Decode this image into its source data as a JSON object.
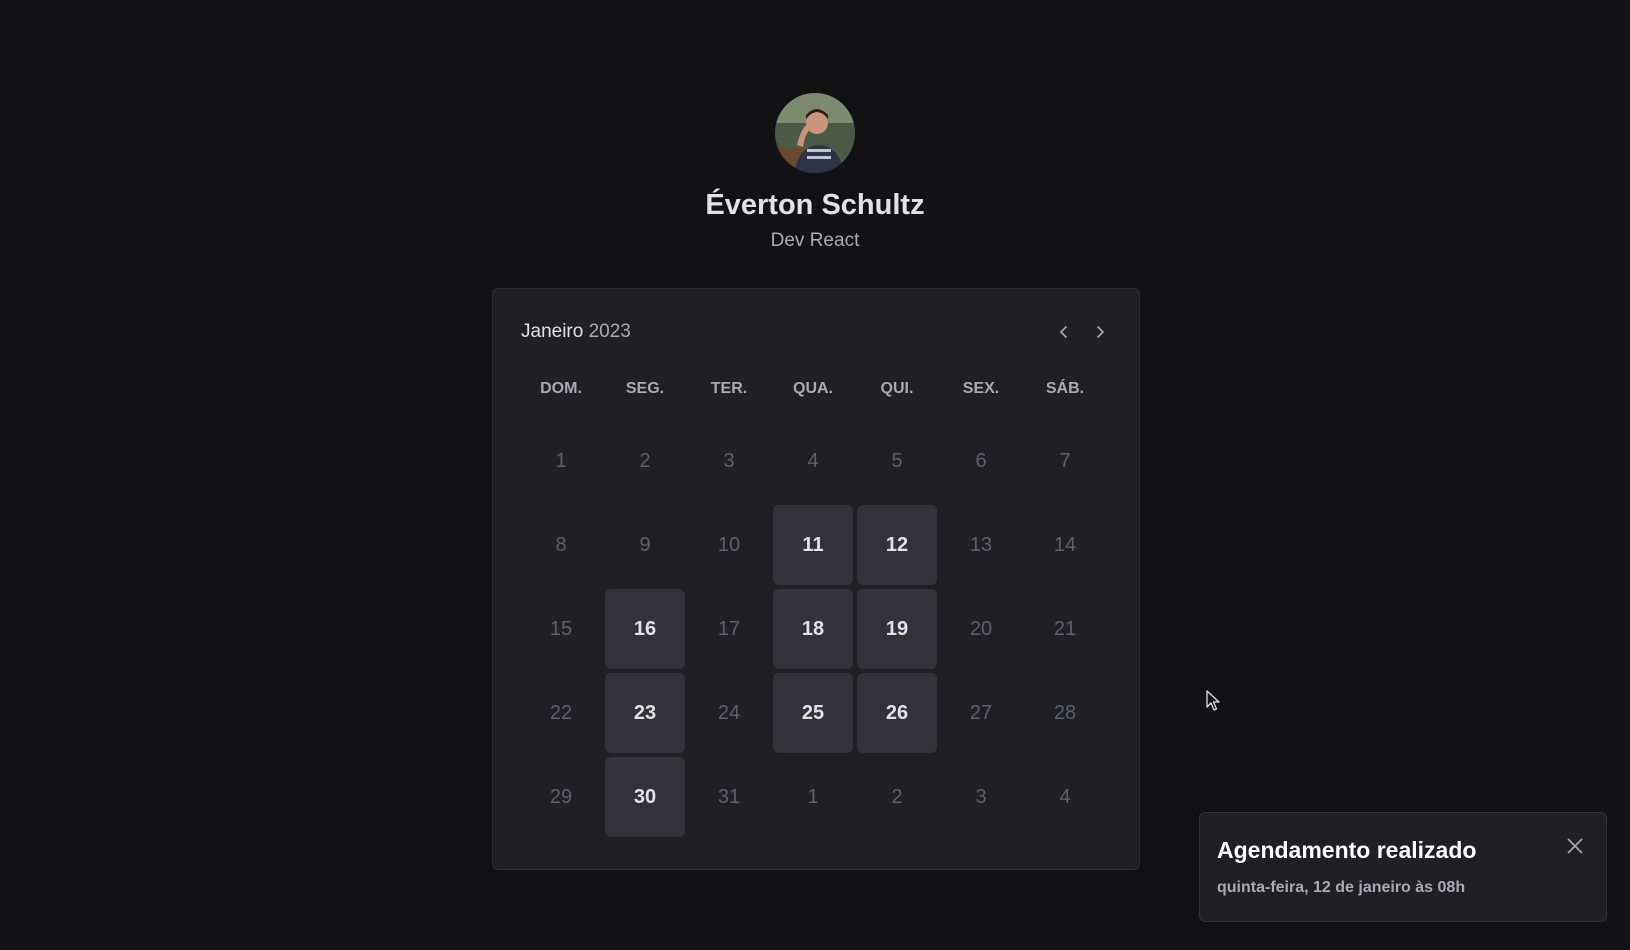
{
  "profile": {
    "name": "Éverton Schultz",
    "bio": "Dev React"
  },
  "calendar": {
    "month": "Janeiro",
    "year": "2023",
    "weekdays": [
      "DOM.",
      "SEG.",
      "TER.",
      "QUA.",
      "QUI.",
      "SEX.",
      "SÁB."
    ],
    "days": [
      {
        "label": "1",
        "available": false
      },
      {
        "label": "2",
        "available": false
      },
      {
        "label": "3",
        "available": false
      },
      {
        "label": "4",
        "available": false
      },
      {
        "label": "5",
        "available": false
      },
      {
        "label": "6",
        "available": false
      },
      {
        "label": "7",
        "available": false
      },
      {
        "label": "8",
        "available": false
      },
      {
        "label": "9",
        "available": false
      },
      {
        "label": "10",
        "available": false
      },
      {
        "label": "11",
        "available": true
      },
      {
        "label": "12",
        "available": true
      },
      {
        "label": "13",
        "available": false
      },
      {
        "label": "14",
        "available": false
      },
      {
        "label": "15",
        "available": false
      },
      {
        "label": "16",
        "available": true
      },
      {
        "label": "17",
        "available": false
      },
      {
        "label": "18",
        "available": true
      },
      {
        "label": "19",
        "available": true
      },
      {
        "label": "20",
        "available": false
      },
      {
        "label": "21",
        "available": false
      },
      {
        "label": "22",
        "available": false
      },
      {
        "label": "23",
        "available": true
      },
      {
        "label": "24",
        "available": false
      },
      {
        "label": "25",
        "available": true
      },
      {
        "label": "26",
        "available": true
      },
      {
        "label": "27",
        "available": false
      },
      {
        "label": "28",
        "available": false
      },
      {
        "label": "29",
        "available": false
      },
      {
        "label": "30",
        "available": true
      },
      {
        "label": "31",
        "available": false
      },
      {
        "label": "1",
        "available": false
      },
      {
        "label": "2",
        "available": false
      },
      {
        "label": "3",
        "available": false
      },
      {
        "label": "4",
        "available": false
      }
    ]
  },
  "toast": {
    "title": "Agendamento realizado",
    "description": "quinta-feira, 12 de janeiro às 08h"
  },
  "icons": {
    "prev": "chevron-left-icon",
    "next": "chevron-right-icon",
    "close": "close-icon",
    "cursor": "mouse-pointer-icon"
  },
  "colors": {
    "background": "#121214",
    "panel": "#202024",
    "available_day": "#323238",
    "text": "#e1e1e6",
    "muted": "#a9a9b2",
    "disabled": "#5f5f6b"
  }
}
